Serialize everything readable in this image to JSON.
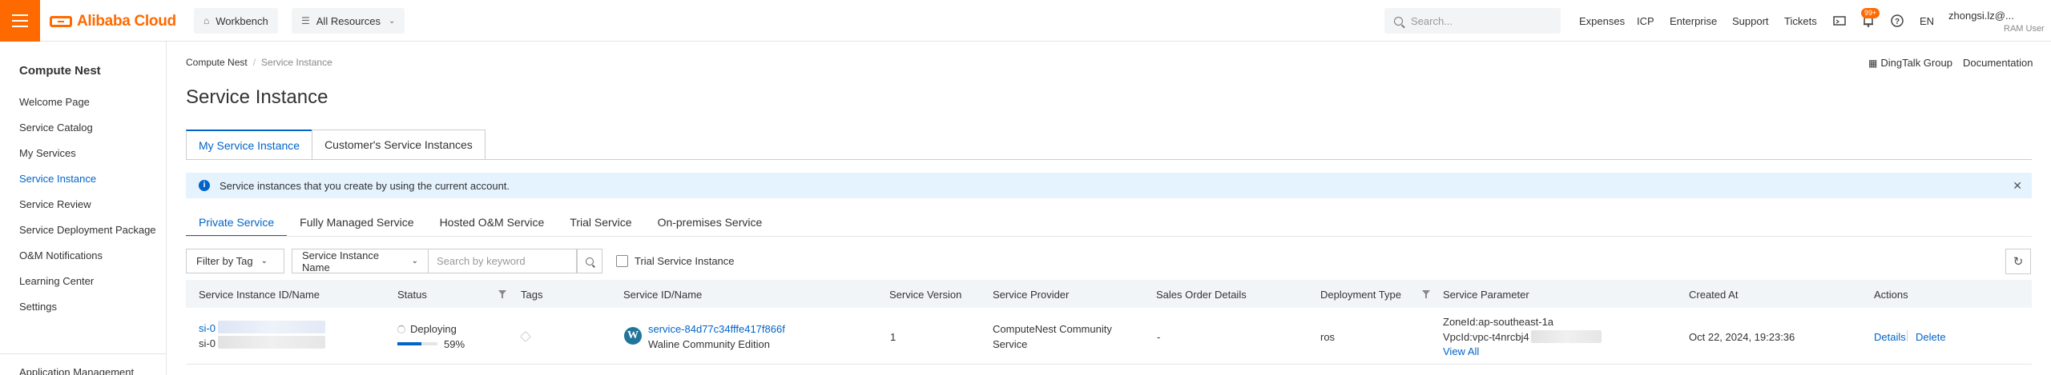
{
  "topbar": {
    "brand": "Alibaba Cloud",
    "workbench": "Workbench",
    "all_resources": "All Resources",
    "search_placeholder": "Search...",
    "links": [
      "Expenses",
      "ICP",
      "Enterprise",
      "Support",
      "Tickets"
    ],
    "notification_badge": "99+",
    "language": "EN",
    "user_name": "zhongsi.lz@...",
    "user_role": "RAM User",
    "accent_color": "#ff6a00"
  },
  "sidebar": {
    "title": "Compute Nest",
    "items": [
      {
        "label": "Welcome Page",
        "active": false
      },
      {
        "label": "Service Catalog",
        "active": false
      },
      {
        "label": "My Services",
        "active": false
      },
      {
        "label": "Service Instance",
        "active": true
      },
      {
        "label": "Service Review",
        "active": false
      },
      {
        "label": "Service Deployment Package",
        "active": false
      },
      {
        "label": "O&M Notifications",
        "active": false
      },
      {
        "label": "Learning Center",
        "active": false
      },
      {
        "label": "Settings",
        "active": false
      }
    ],
    "bottom_item": "Application Management"
  },
  "header": {
    "breadcrumb_root": "Compute Nest",
    "breadcrumb_sep": "/",
    "breadcrumb_current": "Service Instance",
    "title": "Service Instance",
    "dingtalk": "DingTalk Group",
    "documentation": "Documentation"
  },
  "tabs": [
    "My Service Instance",
    "Customer's Service Instances"
  ],
  "alert": {
    "message": "Service instances that you create by using the current account."
  },
  "subtabs": [
    "Private Service",
    "Fully Managed Service",
    "Hosted O&M Service",
    "Trial Service",
    "On-premises Service"
  ],
  "filters": {
    "tag": "Filter by Tag",
    "field": "Service Instance Name",
    "keyword_placeholder": "Search by keyword",
    "trial_checkbox": "Trial Service Instance"
  },
  "table": {
    "columns": [
      "Service Instance ID/Name",
      "Status",
      "Tags",
      "Service ID/Name",
      "Service Version",
      "Service Provider",
      "Sales Order Details",
      "Deployment Type",
      "Service Parameter",
      "Created At",
      "Actions"
    ],
    "rows": [
      {
        "instance_id": "si-0",
        "instance_name": "si-0",
        "status": "Deploying",
        "progress_label": "59%",
        "progress": 0.59,
        "service_id": "service-84d77c34fffe417f866f",
        "service_name": "Waline Community Edition",
        "service_icon": "wordpress-icon",
        "version": "1",
        "provider_line1": "ComputeNest Community",
        "provider_line2": "Service",
        "sales_order": "-",
        "deployment_type": "ros",
        "param_zone": "ZoneId:ap-southeast-1a",
        "param_vpc": "VpcId:vpc-t4nrcbj4",
        "view_all": "View All",
        "created_at": "Oct 22, 2024, 19:23:36",
        "action_details": "Details",
        "action_delete": "Delete"
      }
    ]
  }
}
